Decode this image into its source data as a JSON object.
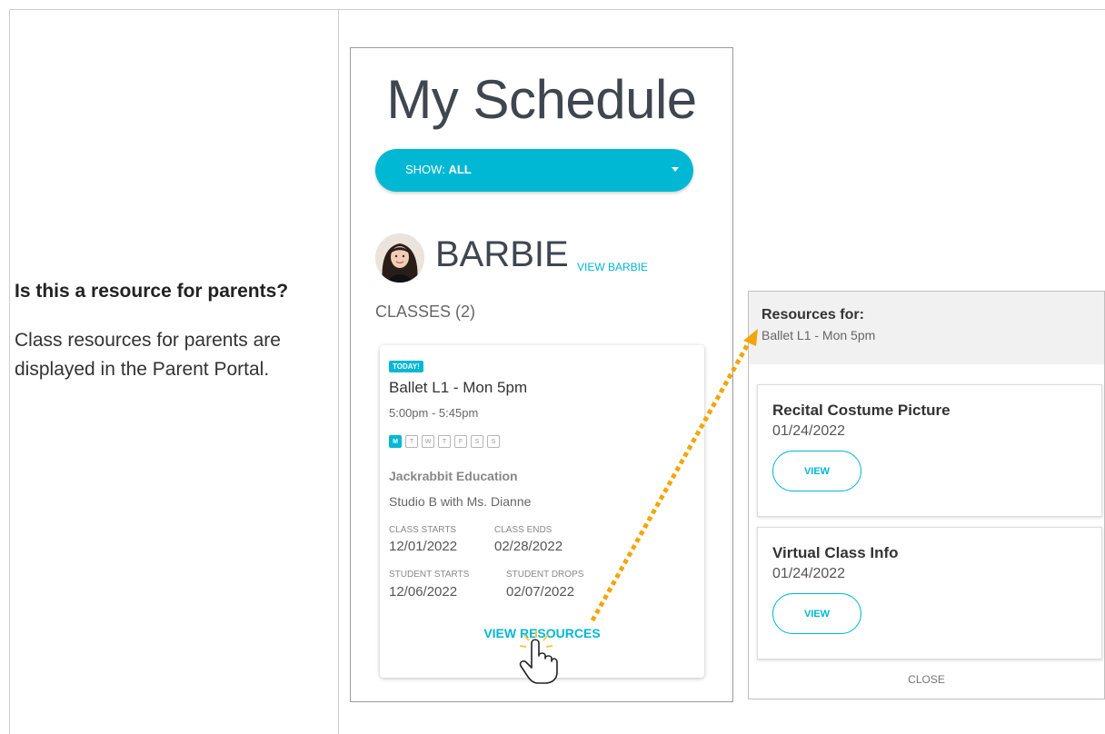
{
  "left": {
    "question": "Is this a resource for parents?",
    "answer": "Class resources for parents are displayed in the Parent Portal."
  },
  "schedule": {
    "title": "My Schedule",
    "show_prefix": "SHOW: ",
    "show_value": "ALL",
    "student_name": "BARBIE",
    "view_student": "VIEW BARBIE",
    "classes_label": "CLASSES (2)",
    "class_card": {
      "badge": "TODAY!",
      "name": "Ballet L1 - Mon 5pm",
      "time": "5:00pm - 5:45pm",
      "days": [
        "M",
        "T",
        "W",
        "T",
        "F",
        "S",
        "S"
      ],
      "active_day": "M",
      "organization": "Jackrabbit Education",
      "room": "Studio B with Ms. Dianne",
      "class_starts_label": "CLASS STARTS",
      "class_starts": "12/01/2022",
      "class_ends_label": "CLASS ENDS",
      "class_ends": "02/28/2022",
      "student_starts_label": "STUDENT STARTS",
      "student_starts": "12/06/2022",
      "student_drops_label": "STUDENT DROPS",
      "student_drops": "02/07/2022",
      "view_resources": "VIEW RESOURCES"
    }
  },
  "resources": {
    "heading": "Resources for:",
    "class_name": "Ballet L1 - Mon 5pm",
    "items": [
      {
        "title": "Recital Costume Picture",
        "date": "01/24/2022",
        "button": "VIEW"
      },
      {
        "title": "Virtual Class Info",
        "date": "01/24/2022",
        "button": "VIEW"
      }
    ],
    "close": "CLOSE"
  },
  "colors": {
    "accent": "#00b8d4",
    "arrow": "#f2a60d",
    "title_text": "#3f4650"
  },
  "icons": {
    "dropdown": "caret-down-icon",
    "cursor": "hand-pointer-icon",
    "arrow": "dotted-arrow-icon"
  }
}
